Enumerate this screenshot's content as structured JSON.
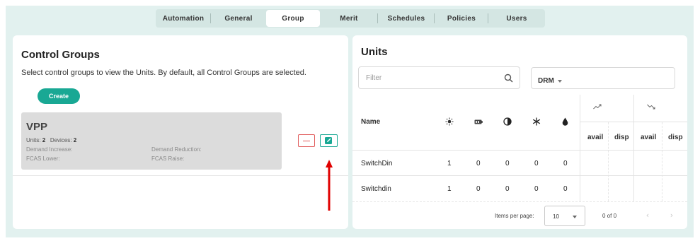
{
  "tabs": [
    {
      "label": "Automation",
      "active": false
    },
    {
      "label": "General",
      "active": false
    },
    {
      "label": "Group",
      "active": true
    },
    {
      "label": "Merit",
      "active": false
    },
    {
      "label": "Schedules",
      "active": false
    },
    {
      "label": "Policies",
      "active": false
    },
    {
      "label": "Users",
      "active": false
    }
  ],
  "control_groups": {
    "title": "Control Groups",
    "description": "Select control groups to view the Units. By default, all Control Groups are selected.",
    "create_label": "Create",
    "group": {
      "name": "VPP",
      "units_label": "Units:",
      "units_value": "2",
      "devices_label": "Devices:",
      "devices_value": "2",
      "demand_increase_label": "Demand Increase:",
      "demand_reduction_label": "Demand Reduction:",
      "fcas_lower_label": "FCAS Lower:",
      "fcas_raise_label": "FCAS Raise:"
    }
  },
  "units": {
    "title": "Units",
    "filter_placeholder": "Filter",
    "drm_label": "DRM",
    "columns": {
      "name": "Name",
      "icons": [
        "sun-icon",
        "battery-icon",
        "contrast-icon",
        "snowflake-icon",
        "water-drop-icon"
      ],
      "trend_up_icon": "trend-up-icon",
      "trend_down_icon": "trend-down-icon",
      "avail": "avail",
      "disp": "disp"
    },
    "rows": [
      {
        "name": "SwitchDin",
        "values": [
          "1",
          "0",
          "0",
          "0",
          "0"
        ]
      },
      {
        "name": "Switchdin",
        "values": [
          "1",
          "0",
          "0",
          "0",
          "0"
        ]
      }
    ],
    "pagination": {
      "items_per_page_label": "Items per page:",
      "items_per_page": "10",
      "range": "0 of 0",
      "prev_icon": "chevron-left-icon",
      "next_icon": "chevron-right-icon"
    }
  },
  "colors": {
    "accent": "#19a894",
    "danger": "#e05a5a",
    "background": "#e2f1ef",
    "annotation_arrow": "#e00000"
  }
}
